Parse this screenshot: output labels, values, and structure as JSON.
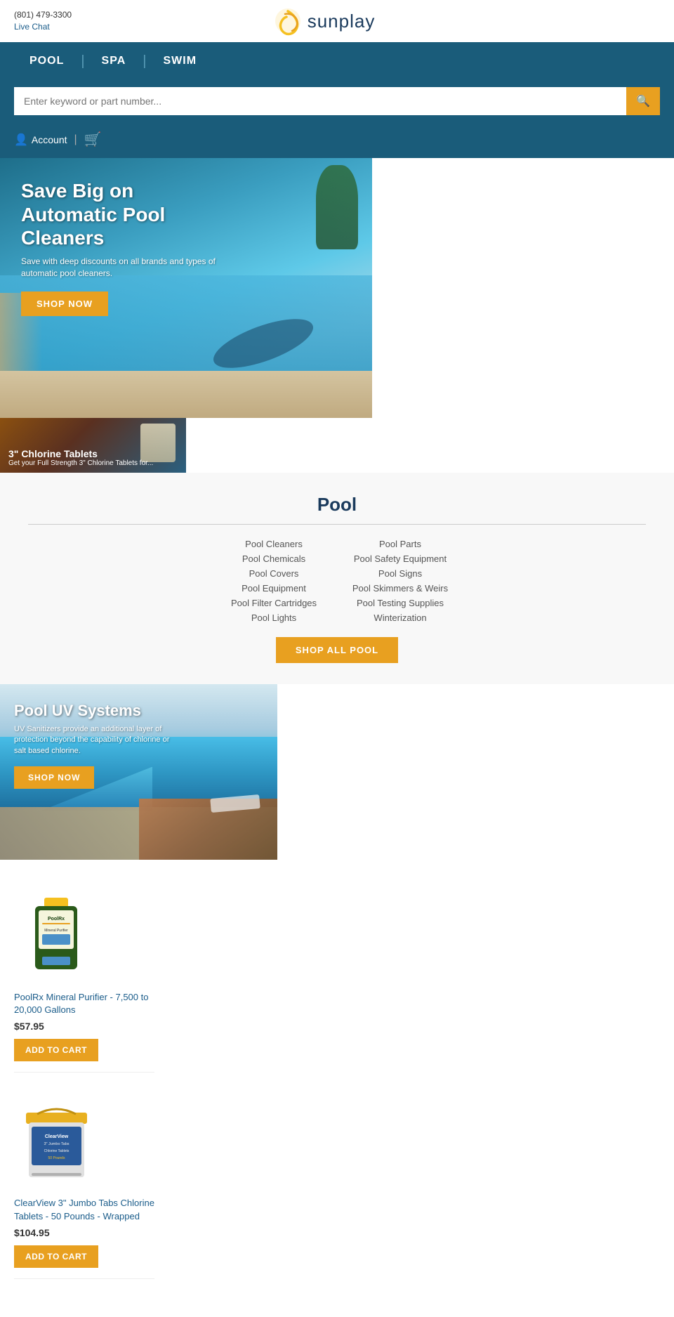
{
  "site": {
    "phone": "(801) 479-3300",
    "live_chat": "Live Chat",
    "logo_text": "sunplay"
  },
  "nav": {
    "items": [
      {
        "label": "POOL",
        "id": "pool"
      },
      {
        "label": "SPA",
        "id": "spa"
      },
      {
        "label": "SWIM",
        "id": "swim"
      }
    ]
  },
  "search": {
    "placeholder": "Enter keyword or part number...",
    "button_icon": "🔍"
  },
  "account": {
    "label": "Account",
    "cart_icon": "🛒"
  },
  "hero": {
    "title": "Save Big on Automatic Pool Cleaners",
    "subtitle": "Save with deep discounts on all brands and types of automatic pool cleaners.",
    "cta": "SHOP NOW"
  },
  "chlorine_banner": {
    "title": "3\" Chlorine Tablets",
    "subtitle": "Get your Full Strength 3\" Chlorine Tablets for..."
  },
  "pool_section": {
    "title": "Pool",
    "categories_left": [
      "Pool Cleaners",
      "Pool Chemicals",
      "Pool Covers",
      "Pool Equipment",
      "Pool Filter Cartridges",
      "Pool Lights"
    ],
    "categories_right": [
      "Pool Parts",
      "Pool Safety Equipment",
      "Pool Signs",
      "Pool Skimmers & Weirs",
      "Pool Testing Supplies",
      "Winterization"
    ],
    "shop_all_btn": "SHOP ALL POOL"
  },
  "uv_banner": {
    "title": "Pool UV Systems",
    "subtitle": "UV Sanitizers provide an additional layer of protection beyond the capability of chlorine or salt based chlorine.",
    "cta": "SHOP NOW"
  },
  "products": [
    {
      "id": "poolrx",
      "name": "PoolRx Mineral Purifier - 7,500 to 20,000 Gallons",
      "price": "$57.95",
      "add_to_cart": "ADD TO CART"
    },
    {
      "id": "clearview",
      "name": "ClearView 3\" Jumbo Tabs Chlorine Tablets - 50 Pounds - Wrapped",
      "price": "$104.95",
      "add_to_cart": "ADD TO CART"
    }
  ],
  "colors": {
    "nav_bg": "#1a5c7a",
    "accent": "#e8a020",
    "link": "#1a5c8a",
    "text_dark": "#1a3a5c"
  }
}
